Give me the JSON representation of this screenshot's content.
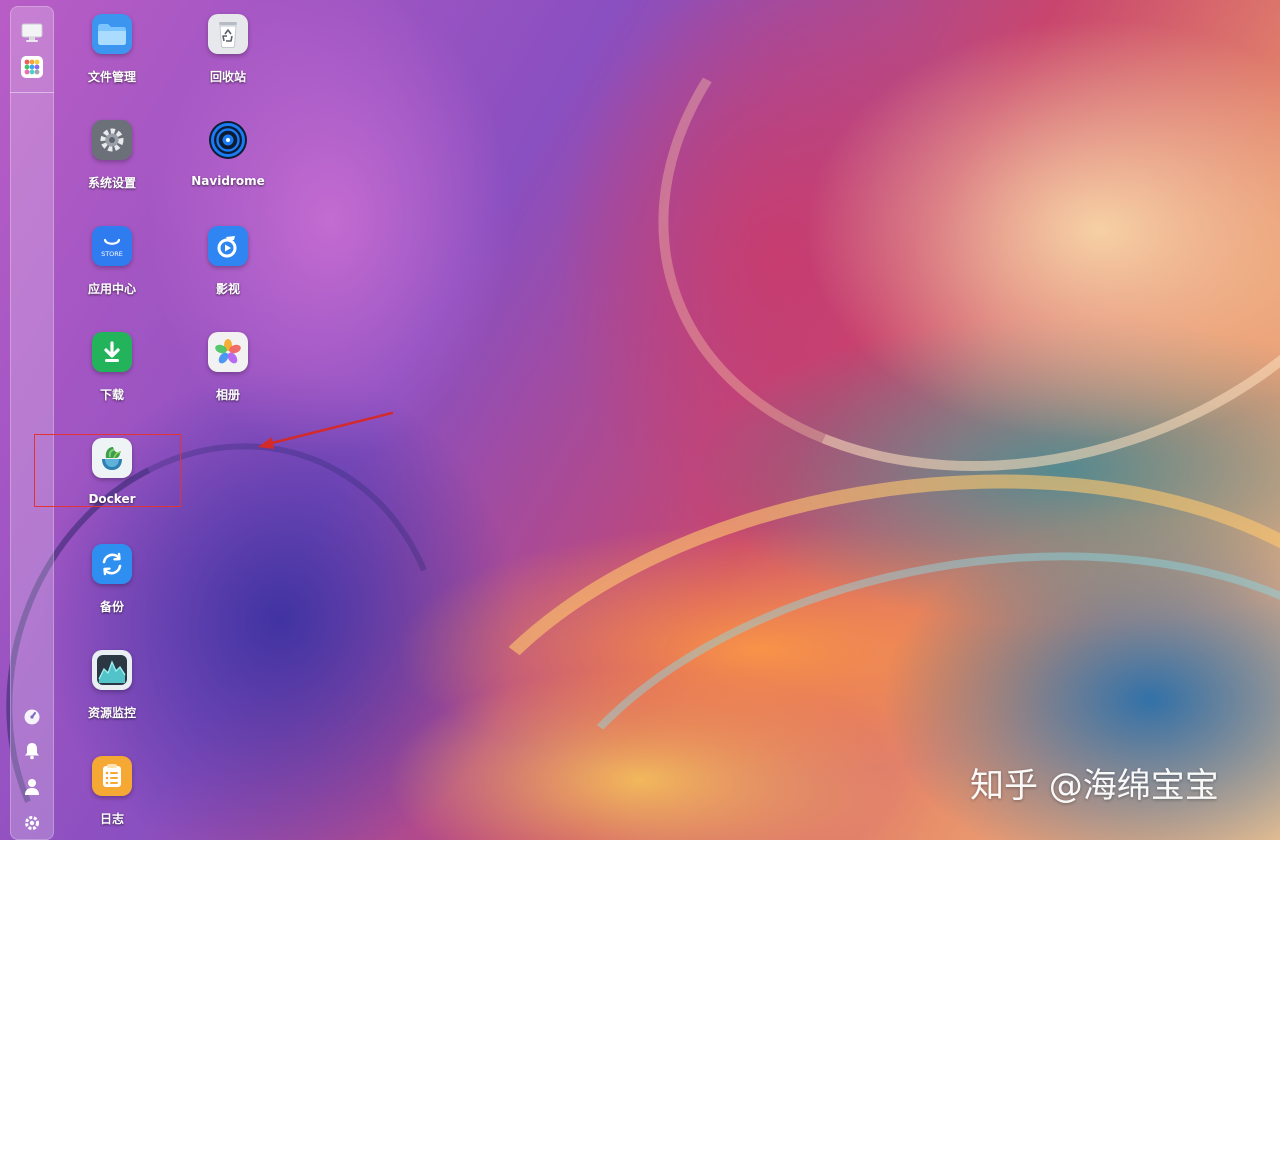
{
  "desktop": {
    "apps": [
      {
        "id": "files",
        "label": "文件管理",
        "icon": "folder-icon",
        "color": "#3c95ef"
      },
      {
        "id": "trash",
        "label": "回收站",
        "icon": "recycle-bin-icon",
        "color": "#e6e8ec"
      },
      {
        "id": "settings",
        "label": "系统设置",
        "icon": "gear-icon",
        "color": "#6b7079"
      },
      {
        "id": "navidrome",
        "label": "Navidrome",
        "icon": "vinyl-record-icon",
        "color": "#1265e6"
      },
      {
        "id": "store",
        "label": "应用中心",
        "icon": "shopping-bag-icon",
        "color": "#2f7cf0"
      },
      {
        "id": "video",
        "label": "影视",
        "icon": "play-icon",
        "color": "#2f86f2"
      },
      {
        "id": "download",
        "label": "下载",
        "icon": "download-icon",
        "color": "#23b45b"
      },
      {
        "id": "photos",
        "label": "相册",
        "icon": "photo-flower-icon",
        "color": "#f2f2f2"
      },
      {
        "id": "docker",
        "label": "Docker",
        "icon": "docker-icon",
        "color": "#eef3f5"
      },
      {
        "id": "backup",
        "label": "备份",
        "icon": "sync-icon",
        "color": "#2f8ff0"
      },
      {
        "id": "monitor",
        "label": "资源监控",
        "icon": "activity-graph-icon",
        "color": "#2b3844"
      },
      {
        "id": "log",
        "label": "日志",
        "icon": "notepad-icon",
        "color": "#f5a833"
      }
    ],
    "store_badge": "STORE"
  },
  "dock": {
    "top_icons": [
      "monitor-icon",
      "launcher-grid-icon"
    ],
    "bottom_icons": [
      "speedometer-icon",
      "bell-icon",
      "user-icon",
      "settings-gear-icon"
    ]
  },
  "annotation": {
    "box_color": "#e23434",
    "arrow_color": "#d42a2a",
    "target": "docker"
  },
  "watermark": {
    "text": "知乎 @海绵宝宝"
  }
}
